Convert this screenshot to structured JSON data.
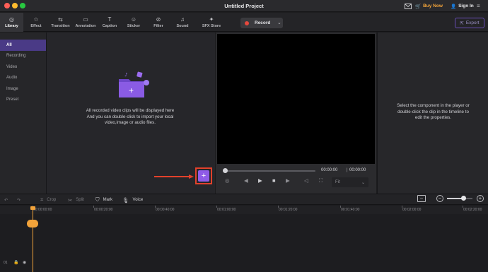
{
  "window": {
    "title": "Untitled Project",
    "buy_now": "Buy Now",
    "sign_in": "Sign In",
    "menu_glyph": "≡"
  },
  "tabs": [
    {
      "label": "Library",
      "icon": "library-icon",
      "glyph": "◎"
    },
    {
      "label": "Effect",
      "icon": "effect-icon",
      "glyph": "☆"
    },
    {
      "label": "Transition",
      "icon": "transition-icon",
      "glyph": "⇆"
    },
    {
      "label": "Annotation",
      "icon": "annotation-icon",
      "glyph": "▭"
    },
    {
      "label": "Caption",
      "icon": "caption-icon",
      "glyph": "T"
    },
    {
      "label": "Sticker",
      "icon": "sticker-icon",
      "glyph": "☺"
    },
    {
      "label": "Filter",
      "icon": "filter-icon",
      "glyph": "⊘"
    },
    {
      "label": "Sound",
      "icon": "sound-icon",
      "glyph": "♫"
    },
    {
      "label": "SFX Store",
      "icon": "sfx-store-icon",
      "glyph": "✦"
    }
  ],
  "record_button": {
    "label": "Record"
  },
  "export_button": {
    "label": "Export",
    "glyph": "⇱"
  },
  "sidebar": {
    "items": [
      "All",
      "Recording",
      "Video",
      "Audio",
      "Image",
      "Preset"
    ]
  },
  "media": {
    "empty_line1": "All recorded video clips will be displayed here",
    "empty_line2": "And you can double-click to import your local",
    "empty_line3": "video,image or audio files.",
    "add_glyph": "+"
  },
  "player": {
    "current_time": "00:00:00",
    "total_time": "00:00:00",
    "fit_value": "Fit",
    "controls": [
      "camera-icon",
      "previous-frame-icon",
      "play-icon",
      "stop-icon",
      "next-frame-icon",
      "volume-icon",
      "fullscreen-icon"
    ],
    "control_glyphs": [
      "◎",
      "◀",
      "▶",
      "■",
      "▶",
      "◁",
      "⛶"
    ]
  },
  "properties": {
    "hint_line1": "Select the component in the player or",
    "hint_line2": "double-click the clip in the timeline to",
    "hint_line3": "edit the properties."
  },
  "timeline_toolbar": {
    "undo_glyph": "↶",
    "redo_glyph": "↷",
    "crop": "Crop",
    "split": "Split",
    "mark": "Mark",
    "voice": "Voice",
    "zoom_box_glyph": "▭",
    "zoom_minus": "−",
    "zoom_plus": "+",
    "zoom_level": 0.65
  },
  "ruler": [
    "00:00:00:00",
    "00:00:20:00",
    "00:00:40:00",
    "00:01:00:00",
    "00:01:20:00",
    "00:01:40:00",
    "00:02:00:00",
    "00:02:20:00"
  ],
  "track": {
    "number": "01",
    "lock_glyph": "🔒",
    "eye_glyph": "◉"
  },
  "colors": {
    "accent": "#8f5be8",
    "brand_orange": "#f2a33a",
    "record_red": "#e5483d",
    "highlight_red": "#e2412b"
  }
}
